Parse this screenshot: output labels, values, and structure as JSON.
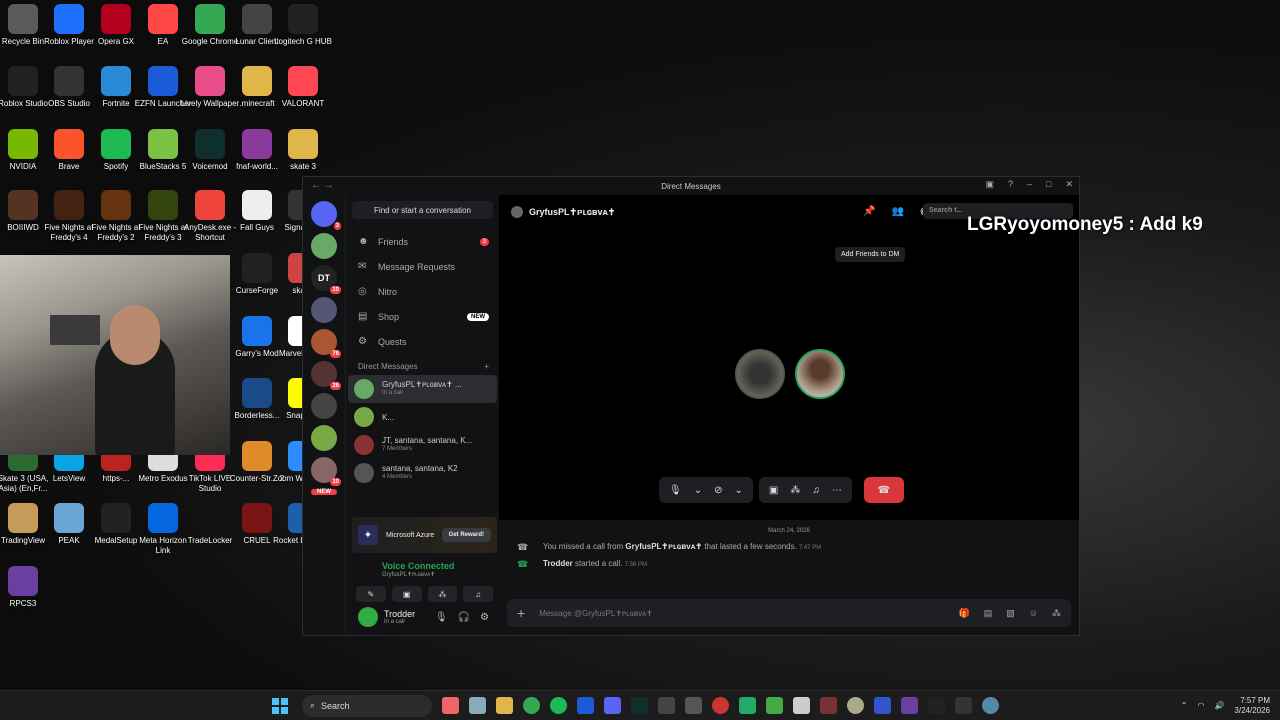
{
  "desktop": {
    "icons": [
      {
        "label": "Recycle Bin",
        "color": "#5a5a5a"
      },
      {
        "label": "Roblox Player",
        "color": "#1f6fff"
      },
      {
        "label": "Opera GX",
        "color": "#b3001e"
      },
      {
        "label": "EA",
        "color": "#ff4747"
      },
      {
        "label": "Google Chrome",
        "color": "#34a853"
      },
      {
        "label": "Lunar Client",
        "color": "#444"
      },
      {
        "label": "Logitech G HUB",
        "color": "#222"
      },
      {
        "label": "Roblox Studio",
        "color": "#222"
      },
      {
        "label": "OBS Studio",
        "color": "#333"
      },
      {
        "label": "Fortnite",
        "color": "#2a8ad8"
      },
      {
        "label": "EZFN Launcher",
        "color": "#1c5bd8"
      },
      {
        "label": "Lively Wallpaper",
        "color": "#e84d8a"
      },
      {
        "label": ".minecraft",
        "color": "#e0b64a"
      },
      {
        "label": "VALORANT",
        "color": "#ff4655"
      },
      {
        "label": "NVIDIA",
        "color": "#76b900"
      },
      {
        "label": "Brave",
        "color": "#fb542b"
      },
      {
        "label": "Spotify",
        "color": "#1db954"
      },
      {
        "label": "BlueStacks 5",
        "color": "#7cc242"
      },
      {
        "label": "Voicemod",
        "color": "#0f2e2e"
      },
      {
        "label": "fnaf-world...",
        "color": "#8a3a9a"
      },
      {
        "label": "skate 3",
        "color": "#e0b64a"
      },
      {
        "label": "BOIIIWD",
        "color": "#553322"
      },
      {
        "label": "Five Nights at Freddy's 4",
        "color": "#442211"
      },
      {
        "label": "Five Nights at Freddy's 2",
        "color": "#663311"
      },
      {
        "label": "Five Nights at Freddy's 3",
        "color": "#334411"
      },
      {
        "label": "AnyDesk.exe - Shortcut",
        "color": "#ef443b"
      },
      {
        "label": "Fall Guys",
        "color": "#eeeeee"
      },
      {
        "label": "SignalRgb",
        "color": "#333"
      },
      {
        "label": "CurseForge",
        "color": "#222"
      },
      {
        "label": "skate.",
        "color": "#c44"
      },
      {
        "label": "Garry's Mod",
        "color": "#1a73e8"
      },
      {
        "label": "Marvel Rivals",
        "color": "#fff"
      },
      {
        "label": "Borderless...",
        "color": "#1a4a8a"
      },
      {
        "label": "Snapchat",
        "color": "#fffc00"
      },
      {
        "label": "Skate 3 (USA, Asia) (En,Fr...",
        "color": "#2c6b2f"
      },
      {
        "label": "LetsView",
        "color": "#0aa3e6"
      },
      {
        "label": "https-...",
        "color": "#b22"
      },
      {
        "label": "Metro Exodus",
        "color": "#ddd"
      },
      {
        "label": "TikTok LIVE Studio",
        "color": "#fe2c55"
      },
      {
        "label": "Counter-Str... 2",
        "color": "#e08a2a"
      },
      {
        "label": "Zoom Workplace",
        "color": "#2d8cff"
      },
      {
        "label": "TradingView",
        "color": "#c69b5a"
      },
      {
        "label": "PEAK",
        "color": "#6aa6d8"
      },
      {
        "label": "MedalSetup",
        "color": "#222"
      },
      {
        "label": "Meta Horizon Link",
        "color": "#0668e1"
      },
      {
        "label": "TradeLocker",
        "color": "#111"
      },
      {
        "label": "CRUEL",
        "color": "#7a1414"
      },
      {
        "label": "Rocket League®",
        "color": "#1d5fa8"
      },
      {
        "label": "RPCS3",
        "color": "#6b3fa0"
      }
    ]
  },
  "discord": {
    "title": "Direct Messages",
    "find_placeholder": "Find or start a conversation",
    "guild_badges": [
      "3",
      "10",
      "76",
      "26",
      "10"
    ],
    "guild_new": "NEW",
    "nav": [
      {
        "label": "Friends",
        "badge": "3",
        "icon": "friends-icon",
        "glyph": "☻"
      },
      {
        "label": "Message Requests",
        "badge": "",
        "icon": "mail-icon",
        "glyph": "✉"
      },
      {
        "label": "Nitro",
        "badge": "",
        "icon": "nitro-icon",
        "glyph": "◎"
      },
      {
        "label": "Shop",
        "badge": "NEW",
        "icon": "shop-icon",
        "glyph": "▤"
      },
      {
        "label": "Quests",
        "badge": "",
        "icon": "quests-icon",
        "glyph": "⚙"
      }
    ],
    "dm_header": "Direct Messages",
    "dms": [
      {
        "name": "GryfusPL✝ᴘʟɢʙᴠᴀ✝ ...",
        "sub": "In a call"
      },
      {
        "name": "K...",
        "sub": ""
      },
      {
        "name": "JT, santana, santana, K...",
        "sub": "7 Members"
      },
      {
        "name": "santana, santana, K2",
        "sub": "4 Members"
      }
    ],
    "promo": {
      "name": "Microsoft Azure",
      "cta": "Get Reward!"
    },
    "voice": {
      "status": "Voice Connected",
      "channel": "GryfusPL✝ᴘʟɢʙᴠᴀ✝"
    },
    "user": {
      "name": "Trodder",
      "status": "In a call"
    },
    "chat_header": "GryfusPL✝ᴘʟɢʙᴠᴀ✝",
    "search_placeholder": "Search t...",
    "tooltip": "Add Friends to DM",
    "date": "March 24, 2026",
    "messages": [
      {
        "pre": "You missed a call from ",
        "who": "GryfusPL✝ᴘʟɢʙᴠᴀ✝",
        "post": " that lasted a few seconds.",
        "time": "7:47 PM",
        "icon_color": "#aaaaaa"
      },
      {
        "pre": "",
        "who": "Trodder",
        "post": " started a call.",
        "time": "7:56 PM",
        "icon_color": "#23a55a"
      }
    ],
    "composer_placeholder": "Message @GryfusPL✝ᴘʟɢʙᴠᴀ✝"
  },
  "overlay": {
    "text": "LGRyoyomoney5 : Add k9"
  },
  "taskbar": {
    "search": "Search",
    "time": "7:57 PM",
    "date": "3/24/2026"
  }
}
